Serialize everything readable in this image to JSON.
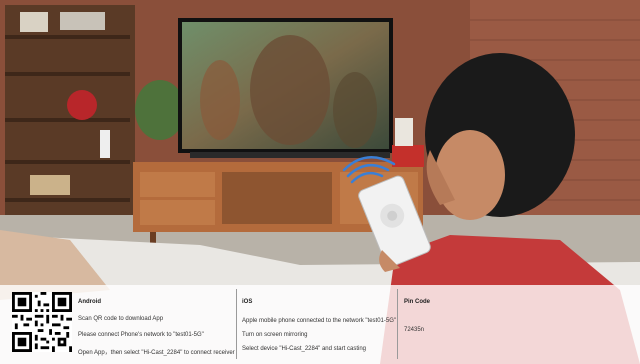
{
  "android": {
    "heading": "Android",
    "lines": [
      "Scan QR code to download App",
      "Please connect Phone's network to \"test01-5G\"",
      "Open App，then select \"Hi-Cast_2284\" to connect receiver"
    ]
  },
  "ios": {
    "heading": "iOS",
    "lines": [
      "Apple mobile phone connected to the network \"test01-5G\"",
      "Turn on screen mirroring",
      "Select device \"Hi-Cast_2284\" and start casting"
    ]
  },
  "pin": {
    "heading": "Pin Code",
    "value": "72435n"
  },
  "icons": [
    "qr-code-icon",
    "wifi-signal-icon"
  ]
}
